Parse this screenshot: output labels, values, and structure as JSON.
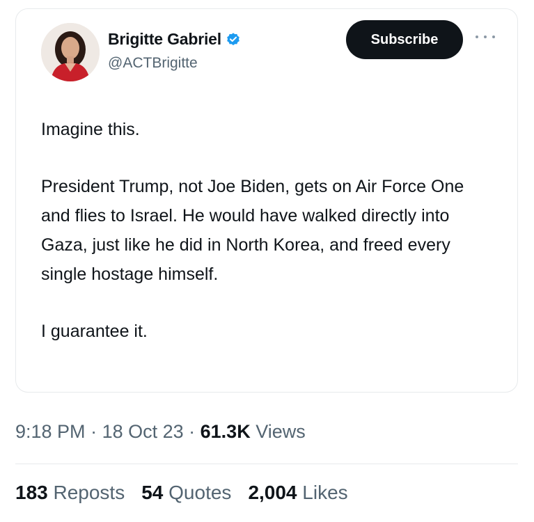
{
  "author": {
    "name": "Brigitte Gabriel",
    "handle": "@ACTBrigitte",
    "verified_color": "#1d9bf0"
  },
  "actions": {
    "subscribe_label": "Subscribe",
    "more_icon": "more-horizontal-icon"
  },
  "tweet": {
    "paragraphs": [
      "Imagine this.",
      "President Trump, not Joe Biden, gets on Air Force One and flies to Israel. He would have walked directly into Gaza, just like he did in North Korea, and freed every single hostage himself.",
      "I guarantee it."
    ]
  },
  "meta": {
    "time": "9:18 PM",
    "sep1": " · ",
    "date": "18 Oct 23",
    "sep2": " · ",
    "views_count": "61.3K",
    "views_label": " Views"
  },
  "stats": [
    {
      "count": "183",
      "label": " Reposts"
    },
    {
      "count": "54",
      "label": " Quotes"
    },
    {
      "count": "2,004",
      "label": " Likes"
    }
  ]
}
